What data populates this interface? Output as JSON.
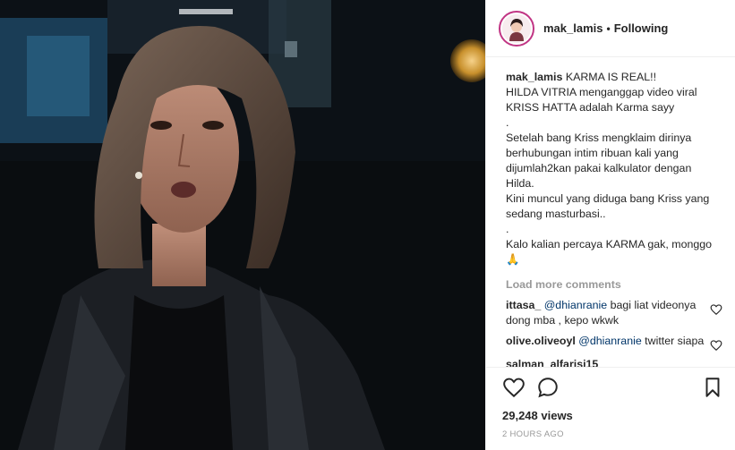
{
  "post": {
    "username": "mak_lamis",
    "separator": "•",
    "follow_status": "Following"
  },
  "caption": {
    "username": "mak_lamis",
    "lines": [
      "KARMA IS REAL!!",
      "HILDA VITRIA menganggap video viral",
      "KRISS HATTA adalah Karma sayy",
      ".",
      "Setelah bang Kriss mengklaim dirinya",
      "berhubungan intim ribuan kali yang",
      "dijumlah2kan pakai kalkulator dengan",
      "Hilda.",
      "Kini muncul yang diduga bang Kriss yang",
      "sedang masturbasi..",
      ".",
      "Kalo kalian percaya KARMA gak, monggo",
      "🙏"
    ]
  },
  "load_more": "Load more comments",
  "comments": [
    {
      "user": "ittasa_",
      "mention": "@dhianranie",
      "text": " bagi liat videonya dong mba , kepo wkwk"
    },
    {
      "user": "olive.oliveoyl",
      "mention": "@dhianranie",
      "text": " twitter siapa"
    },
    {
      "user": "salman_alfarisi15",
      "mention": "",
      "text": ""
    }
  ],
  "likes": "29,248 views",
  "time_ago": "2 HOURS AGO",
  "colors": {
    "story_ring": "#c13584",
    "mention": "#003569",
    "muted": "#999999"
  }
}
